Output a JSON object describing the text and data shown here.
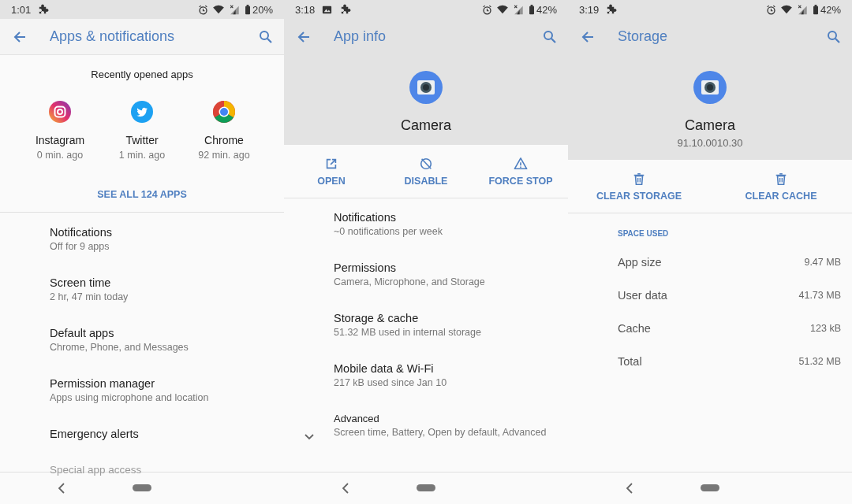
{
  "panels": [
    {
      "status": {
        "time": "1:01",
        "notifications": [
          {
            "kind": "puzzle"
          }
        ],
        "battery": "20%"
      },
      "toolbar": {
        "title": "Apps & notifications"
      },
      "recent": {
        "heading": "Recently opened apps",
        "apps": [
          {
            "kind": "instagram",
            "name": "Instagram",
            "time": "0 min. ago"
          },
          {
            "kind": "twitter",
            "name": "Twitter",
            "time": "1 min. ago"
          },
          {
            "kind": "chrome",
            "name": "Chrome",
            "time": "92 min. ago"
          }
        ],
        "link": "SEE ALL 124 APPS"
      },
      "items": [
        {
          "kind": "entry",
          "title": "Notifications",
          "subtitle": "Off for 9 apps"
        },
        {
          "kind": "entry",
          "title": "Screen time",
          "subtitle": "2 hr, 47 min today"
        },
        {
          "kind": "entry",
          "title": "Default apps",
          "subtitle": "Chrome, Phone, and Messages"
        },
        {
          "kind": "entry",
          "title": "Permission manager",
          "subtitle": "Apps using microphone and location"
        },
        {
          "kind": "entry",
          "title": "Emergency alerts"
        },
        {
          "kind": "faded",
          "title": "Special app access"
        }
      ]
    },
    {
      "status": {
        "time": "3:18",
        "notifications": [
          {
            "kind": "image"
          },
          {
            "kind": "puzzle"
          }
        ],
        "battery": "42%"
      },
      "toolbar": {
        "title": "App info"
      },
      "app_header": {
        "name": "Camera"
      },
      "actions": [
        {
          "kind": "open",
          "label": "OPEN"
        },
        {
          "kind": "disable",
          "label": "DISABLE"
        },
        {
          "kind": "warning",
          "label": "FORCE STOP"
        }
      ],
      "items": [
        {
          "kind": "entry",
          "title": "Notifications",
          "subtitle": "~0 notifications per week"
        },
        {
          "kind": "entry",
          "title": "Permissions",
          "subtitle": "Camera, Microphone, and Storage"
        },
        {
          "kind": "entry",
          "title": "Storage & cache",
          "subtitle": "51.32 MB used in internal storage"
        },
        {
          "kind": "entry",
          "title": "Mobile data & Wi-Fi",
          "subtitle": "217 kB used since Jan 10"
        },
        {
          "kind": "expandable",
          "title": "Advanced",
          "subtitle": "Screen time, Battery, Open by default, Advanced",
          "expanded": false
        }
      ]
    },
    {
      "status": {
        "time": "3:19",
        "notifications": [
          {
            "kind": "puzzle"
          }
        ],
        "battery": "42%"
      },
      "toolbar": {
        "title": "Storage"
      },
      "app_header": {
        "name": "Camera",
        "version": "91.10.0010.30"
      },
      "actions": [
        {
          "kind": "delete",
          "label": "CLEAR STORAGE"
        },
        {
          "kind": "delete",
          "label": "CLEAR CACHE"
        }
      ],
      "section_label": "SPACE USED",
      "sizes": [
        {
          "label": "App size",
          "value": "9.47 MB"
        },
        {
          "label": "User data",
          "value": "41.73 MB"
        },
        {
          "label": "Cache",
          "value": "123 kB"
        },
        {
          "label": "Total",
          "value": "51.32 MB"
        }
      ]
    }
  ]
}
